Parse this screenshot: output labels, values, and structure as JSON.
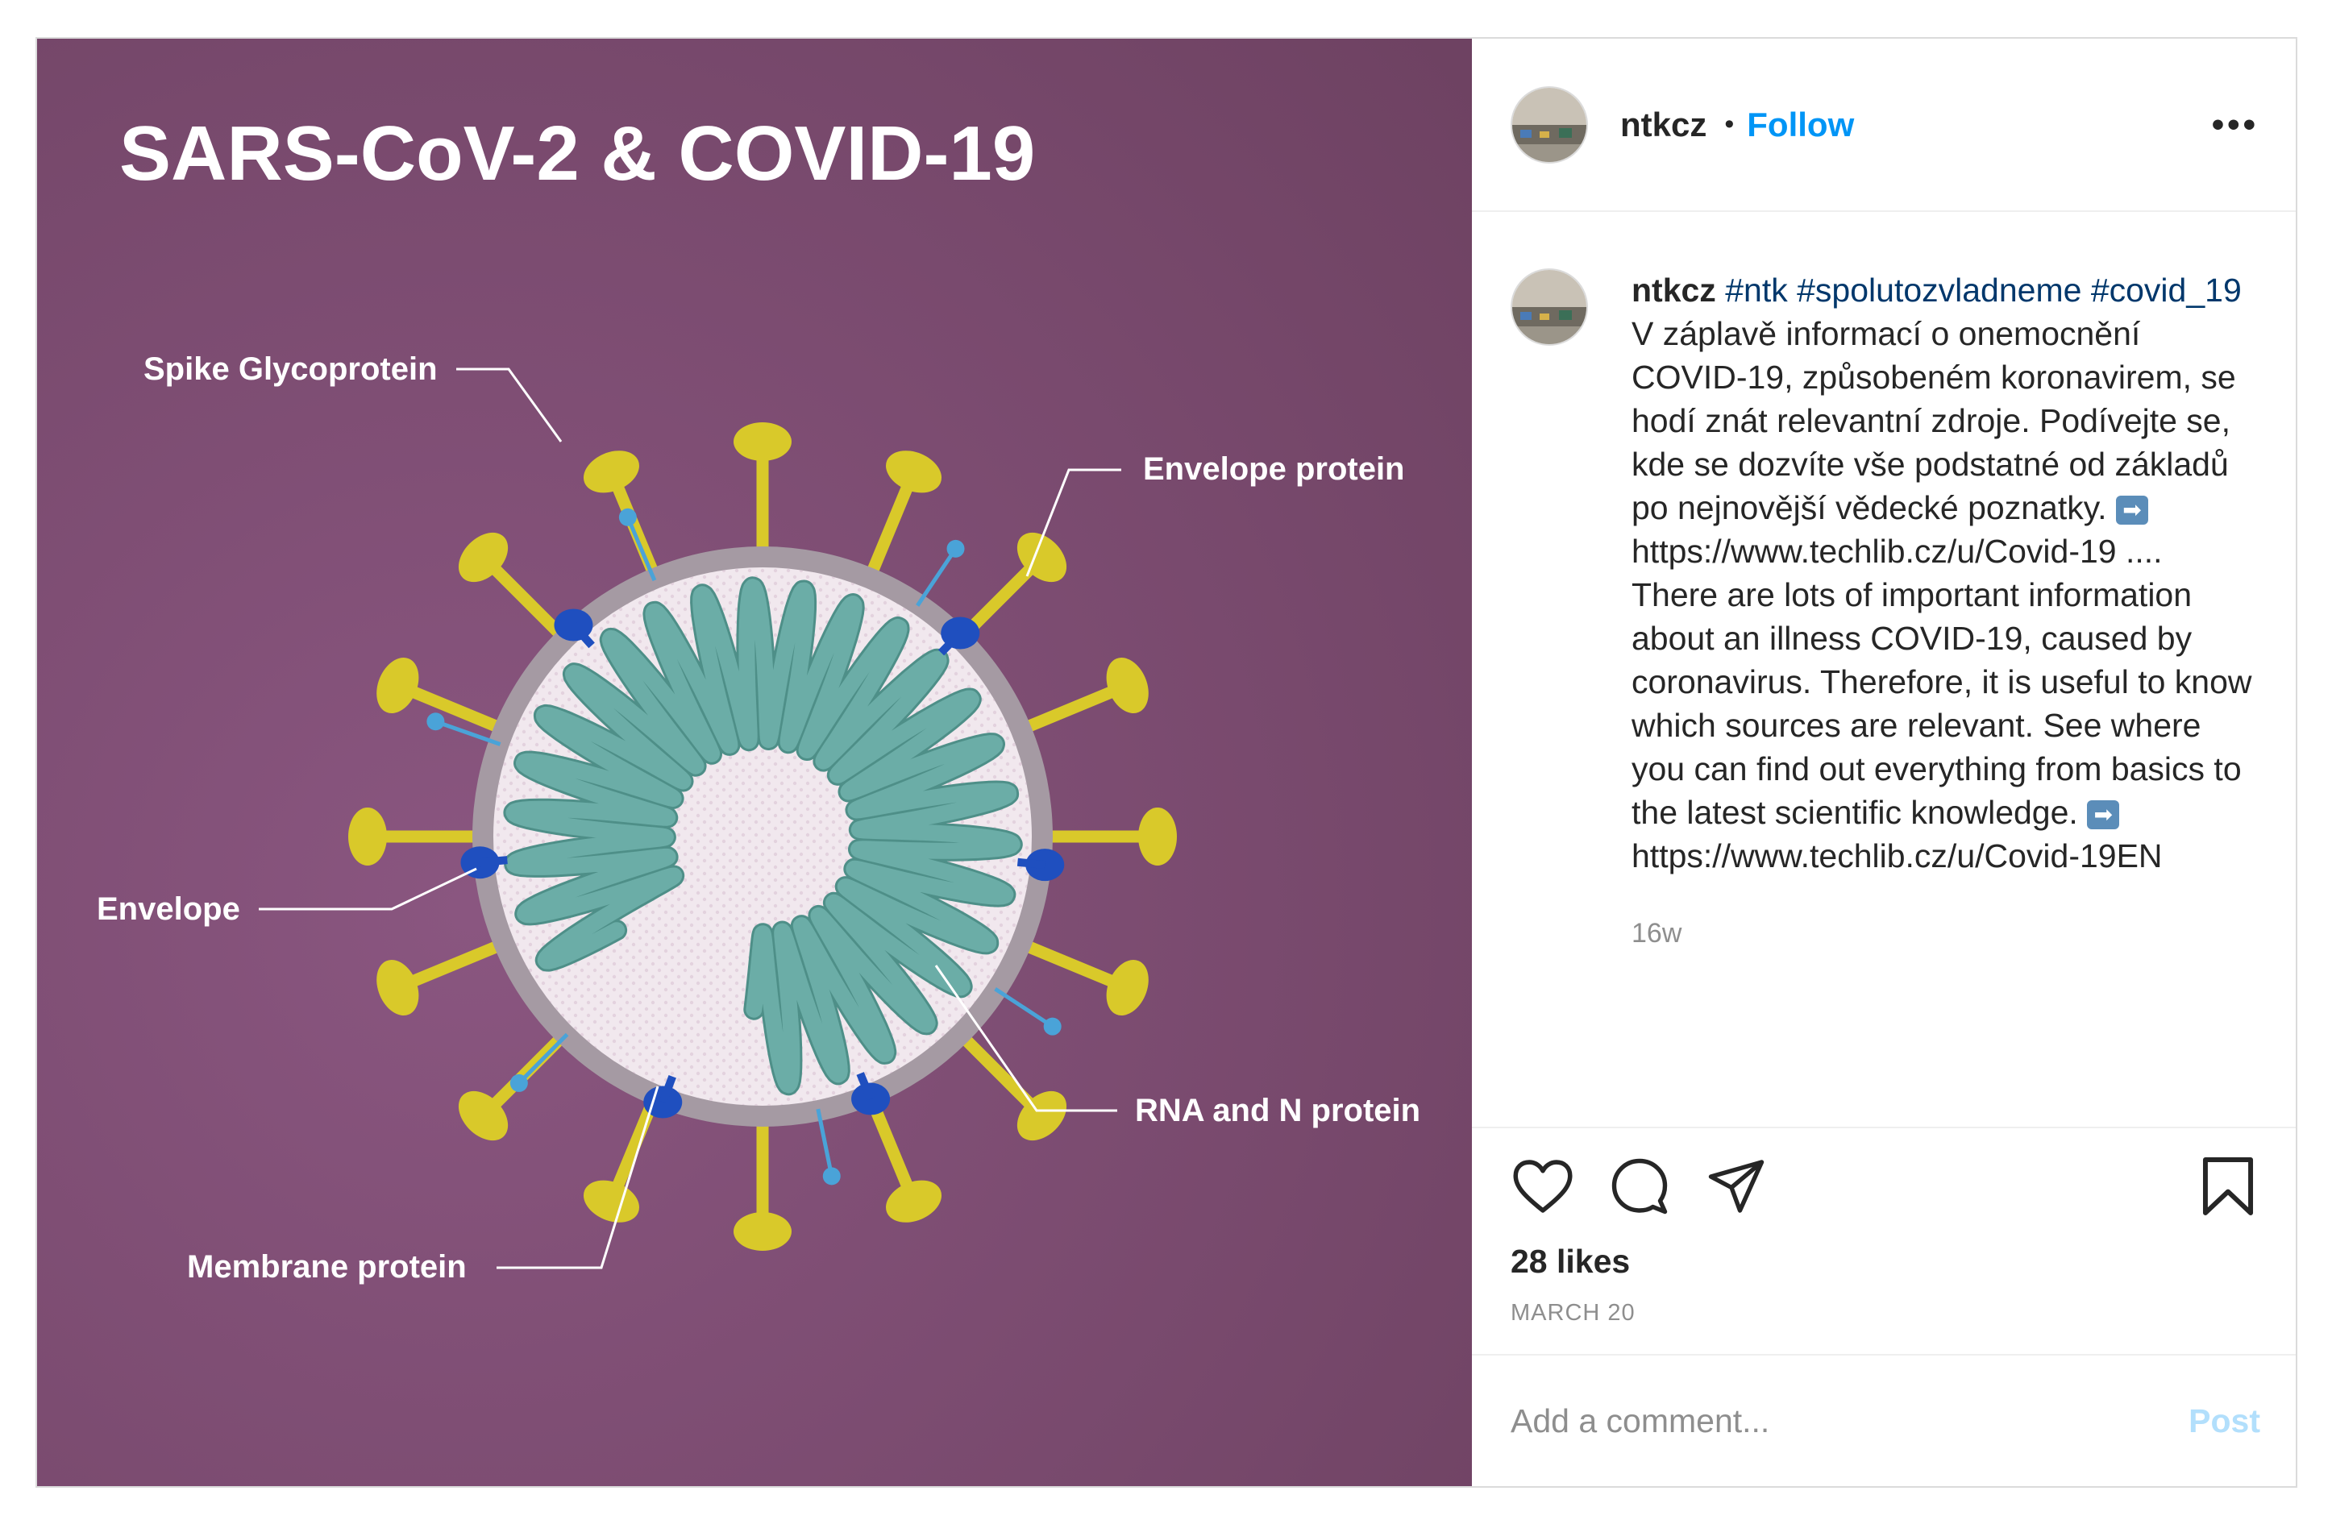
{
  "post": {
    "username": "ntkcz",
    "follow_label": "Follow",
    "more_label": "•••",
    "image": {
      "title": "SARS-CoV-2 & COVID-19",
      "labels": {
        "spike": "Spike Glycoprotein",
        "envelope_protein": "Envelope protein",
        "envelope": "Envelope",
        "rna": "RNA and N protein",
        "membrane": "Membrane protein"
      },
      "colors": {
        "background": "#7c4a70",
        "spike": "#d9c92a",
        "membrane": "#1f4fbf",
        "rna": "#6bada7",
        "envelope_ring": "#a59aa3"
      }
    },
    "caption": {
      "username": "ntkcz",
      "hashtags": [
        "#ntk",
        "#spolutozvladneme",
        "#covid_19"
      ],
      "text_cz": "V záplavě informací o onemocnění COVID-19, způsobeném koronavirem, se hodí znát relevantní zdroje. Podívejte se, kde se dozvíte vše podstatné od základů po nejnovější vědecké poznatky.",
      "link_cz": "https://www.techlib.cz/u/Covid-19 ....",
      "text_en": "There are lots of important information about an illness COVID-19, caused by coronavirus. Therefore, it is useful to know which sources are relevant. See where you can find out everything from basics to the latest scientific knowledge.",
      "link_en": "https://www.techlib.cz/u/Covid-19EN",
      "arrow_emoji": "➡",
      "time": "16w"
    },
    "icons": [
      "heart-icon",
      "comment-icon",
      "share-icon",
      "bookmark-icon"
    ],
    "likes": "28 likes",
    "date": "MARCH 20",
    "comment": {
      "placeholder": "Add a comment...",
      "post_label": "Post"
    }
  }
}
